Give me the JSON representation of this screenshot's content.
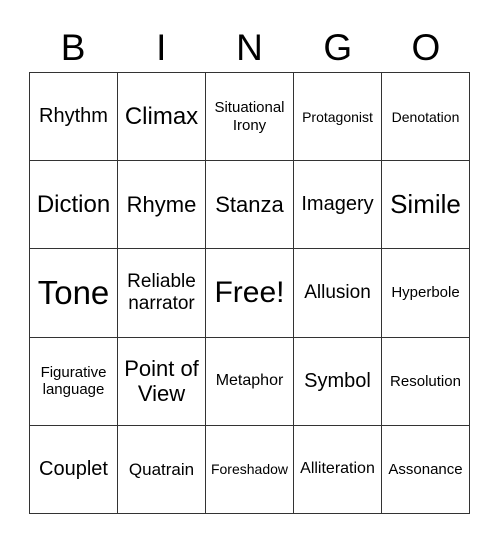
{
  "header": {
    "letters": [
      "B",
      "I",
      "N",
      "G",
      "O"
    ]
  },
  "cells": [
    "Rhythm",
    "Climax",
    "Situational Irony",
    "Protagonist",
    "Denotation",
    "Diction",
    "Rhyme",
    "Stanza",
    "Imagery",
    "Simile",
    "Tone",
    "Reliable narrator",
    "Free!",
    "Allusion",
    "Hyperbole",
    "Figurative language",
    "Point of View",
    "Metaphor",
    "Symbol",
    "Resolution",
    "Couplet",
    "Quatrain",
    "Foreshadow",
    "Alliteration",
    "Assonance"
  ]
}
